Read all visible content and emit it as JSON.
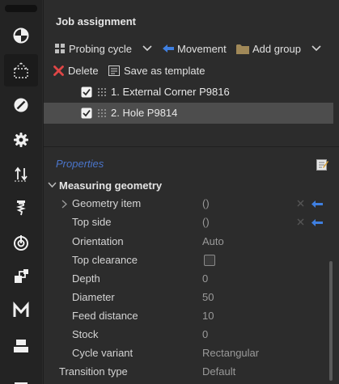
{
  "colors": {
    "accent_blue": "#4a74c9",
    "arrow_blue": "#3f7fe0",
    "delete_red": "#e04646",
    "selected_row": "#4d4d4d"
  },
  "toolbar": {
    "icons": [
      "program-icon",
      "bounding-box-icon",
      "no-entry-icon",
      "gear-icon",
      "transfer-arrows-icon",
      "tool-icon",
      "target-icon",
      "copy-blocks-icon",
      "machine-m-icon",
      "stack-icon",
      "bottom-bar-icon"
    ]
  },
  "job_assignment": {
    "title": "Job assignment",
    "probing_cycle_label": "Probing cycle",
    "movement_label": "Movement",
    "add_group_label": "Add group",
    "delete_label": "Delete",
    "save_template_label": "Save as template",
    "jobs": [
      {
        "label": "1. External Corner P9816",
        "checked": true,
        "selected": false
      },
      {
        "label": "2. Hole P9814",
        "checked": true,
        "selected": true
      }
    ]
  },
  "properties": {
    "link_label": "Properties",
    "section_title": "Measuring geometry",
    "rows": [
      {
        "name": "Geometry item",
        "value": "()"
      },
      {
        "name": "Top side",
        "value": "()"
      },
      {
        "name": "Orientation",
        "value": "Auto"
      },
      {
        "name": "Top clearance",
        "value": ""
      },
      {
        "name": "Depth",
        "value": "0"
      },
      {
        "name": "Diameter",
        "value": "50"
      },
      {
        "name": "Feed distance",
        "value": "10"
      },
      {
        "name": "Stock",
        "value": "0"
      },
      {
        "name": "Cycle variant",
        "value": "Rectangular"
      },
      {
        "name": "Transition type",
        "value": "Default"
      }
    ]
  }
}
